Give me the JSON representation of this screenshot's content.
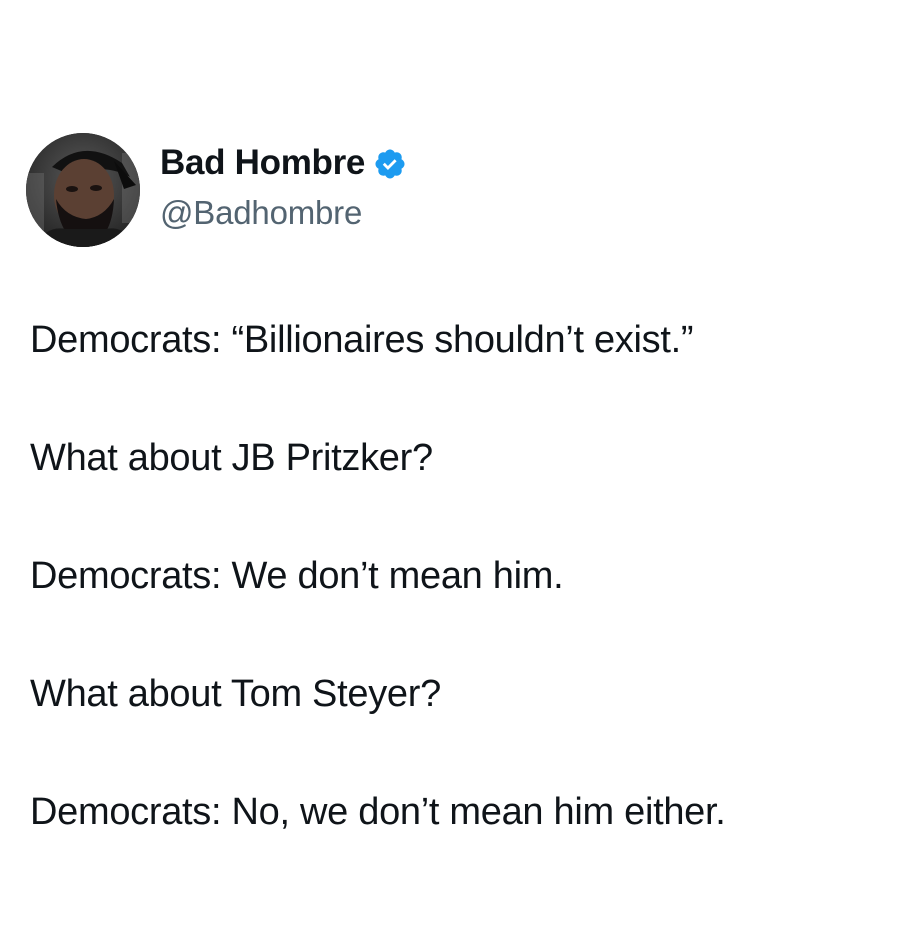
{
  "tweet": {
    "author": {
      "display_name": "Bad Hombre",
      "handle": "@Badhombre",
      "verified": true,
      "verified_color": "#1d9bf0",
      "avatar_icon": "profile-photo"
    },
    "lines": [
      "Democrats: “Billionaires shouldn’t exist.”",
      "What about JB Pritzker?",
      "Democrats: We don’t mean him.",
      "What about Tom Steyer?",
      "Democrats: No, we don’t mean him either."
    ]
  },
  "colors": {
    "text": "#0f1419",
    "secondary_text": "#536471",
    "background": "#ffffff"
  }
}
